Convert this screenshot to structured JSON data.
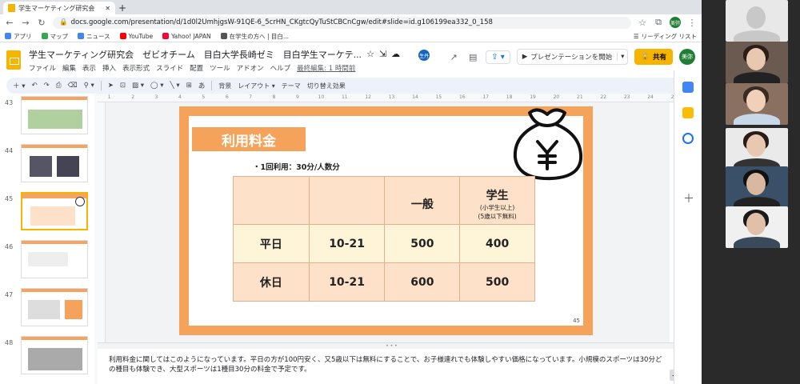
{
  "browser": {
    "tab_title": "学生マーケティング研究会　ゼビオ",
    "new_tab": "+",
    "url": "docs.google.com/presentation/d/1d0l2UmhjgsW-91QE-6_5crHN_CKgtcQyTuStCBCnCgw/edit#slide=id.g106199ea332_0_158",
    "user_initial": "美弥",
    "bookmarks": [
      {
        "label": "アプリ",
        "color": "#4285f4"
      },
      {
        "label": "マップ",
        "color": "#34a853"
      },
      {
        "label": "ニュース",
        "color": "#4285f4"
      },
      {
        "label": "YouTube",
        "color": "#ff0000"
      },
      {
        "label": "Yahoo! JAPAN",
        "color": "#ff0033"
      },
      {
        "label": "在学生の方へ | 目白...",
        "color": "#555555"
      }
    ],
    "reading_list": "リーディング リスト"
  },
  "doc": {
    "title": "学生マーケティング研究会　ゼビオチーム　目白大学長崎ゼミ　目白学生マーケテ...",
    "menus": [
      "ファイル",
      "編集",
      "表示",
      "挿入",
      "表示形式",
      "スライド",
      "配置",
      "ツール",
      "アドオン",
      "ヘルプ"
    ],
    "last_edit": "最終編集: 1 時間前",
    "presence_initial": "生丹",
    "present_label": "プレゼンテーションを開始",
    "share_label": "共有",
    "user_avatar": "美弥"
  },
  "toolbar": {
    "background": "背景",
    "layout": "レイアウト ▾",
    "theme": "テーマ",
    "transition": "切り替え効果",
    "text_style": "あ"
  },
  "ruler": [
    "1",
    "2",
    "3",
    "4",
    "5",
    "6",
    "7",
    "8",
    "9",
    "10",
    "11",
    "12",
    "13",
    "14",
    "15",
    "16",
    "17",
    "18",
    "19",
    "20",
    "21",
    "22",
    "23",
    "24",
    "25"
  ],
  "filmstrip": [
    {
      "num": "43",
      "selected": false
    },
    {
      "num": "44",
      "selected": false
    },
    {
      "num": "45",
      "selected": true
    },
    {
      "num": "46",
      "selected": false
    },
    {
      "num": "47",
      "selected": false
    },
    {
      "num": "48",
      "selected": false
    }
  ],
  "slide": {
    "title": "利用料金",
    "bullet": "・1回利用：30分/人数分",
    "table": {
      "header": [
        "",
        "",
        "一般",
        "学生"
      ],
      "header_sub": [
        "(小学生以上)",
        "(5歳以下無料)"
      ],
      "rows": [
        [
          "平日",
          "10-21",
          "500",
          "400"
        ],
        [
          "休日",
          "10-21",
          "600",
          "500"
        ]
      ]
    },
    "page_number": "45",
    "accent_color": "#f5a35a"
  },
  "notes": "利用料金に関してはこのようになっています。平日の方が100円安く、又5歳以下は無料にすることで、お子様連れでも体験しやすい価格になっています。小規模のスポーツは30分どの種目も体験でき、大型スポーツは1種目30分の料金で予定です。"
}
